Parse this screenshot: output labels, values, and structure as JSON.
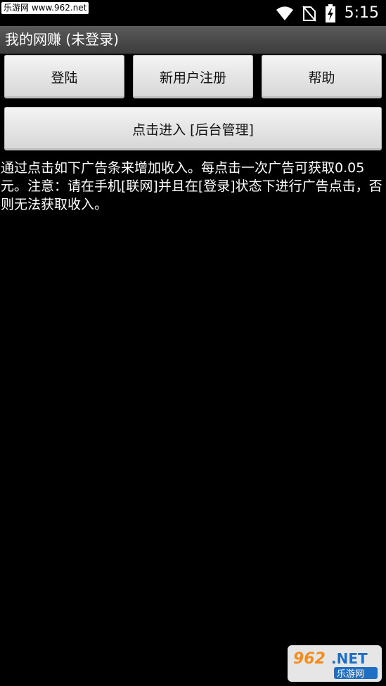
{
  "status_bar": {
    "watermark": "乐游网 www.962.net",
    "time": "5:15",
    "icons": [
      "wifi-icon",
      "no-sim-icon",
      "battery-charging-icon"
    ]
  },
  "title_bar": {
    "title": "我的网赚 (未登录)"
  },
  "buttons": {
    "login": "登陆",
    "register": "新用户注册",
    "help": "帮助",
    "admin": "点击进入 [后台管理]"
  },
  "description": "通过点击如下广告条来增加收入。每点击一次广告可获取0.05元。注意：请在手机[联网]并且在[登录]状态下进行广告点击，否则无法获取收入。",
  "watermark_logo": {
    "text_top": "962.NET",
    "text_bottom": "乐游网"
  },
  "colors": {
    "background": "#000000",
    "title_bar": "#4a4a4a",
    "button": "#e4e4e4",
    "text": "#ffffff",
    "logo_orange": "#f28c1e",
    "logo_blue": "#1f6fc4"
  }
}
